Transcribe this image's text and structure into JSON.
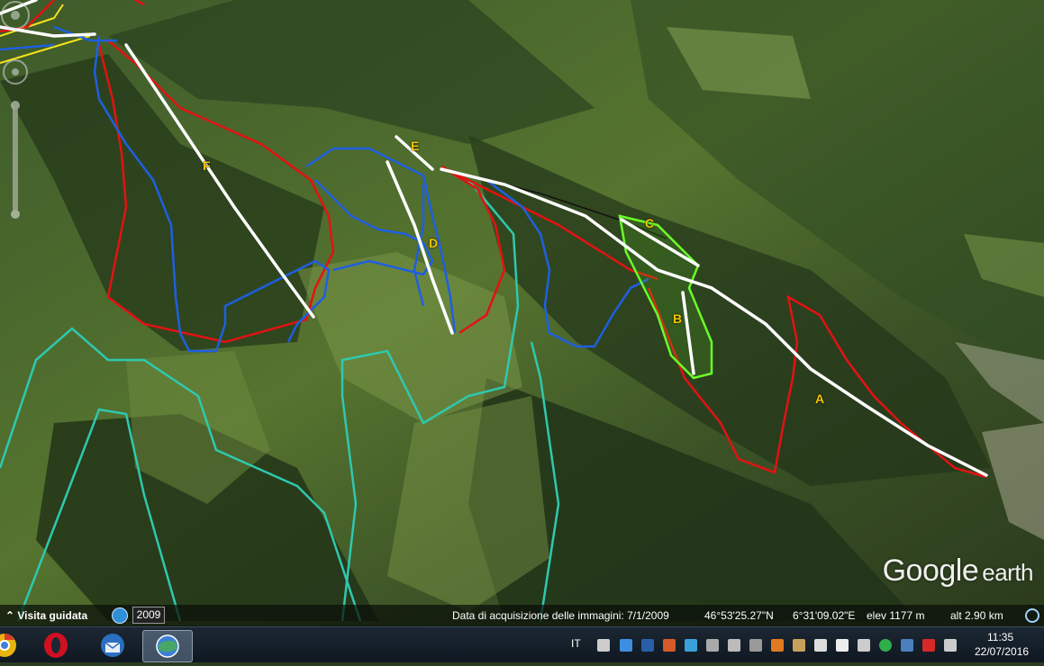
{
  "map": {
    "piste_labels": [
      "A",
      "B",
      "C",
      "D",
      "E",
      "F"
    ],
    "logo_brand": "Google",
    "logo_product": "earth",
    "colors": {
      "red_run": "#e31212",
      "blue_run": "#1f5fe0",
      "white_lift": "#ffffff",
      "green_area": "#6aff2a",
      "teal_line": "#2fc8b0",
      "yellow_line": "#f5e21c",
      "label": "#f2c400"
    }
  },
  "statusbar": {
    "tour_label": "Visita guidata",
    "year": "2009",
    "acquisition_date": "Data di acquisizione delle immagini: 7/1/2009",
    "latitude": "46°53'25.27\"N",
    "longitude": "6°31'09.02\"E",
    "elevation": "elev  1177 m",
    "altitude": "alt  2.90 km"
  },
  "taskbar": {
    "apps": [
      "chrome-icon",
      "opera-icon",
      "thunderbird-icon",
      "google-earth-icon"
    ],
    "language": "IT",
    "time": "11:35",
    "date": "22/07/2016"
  }
}
